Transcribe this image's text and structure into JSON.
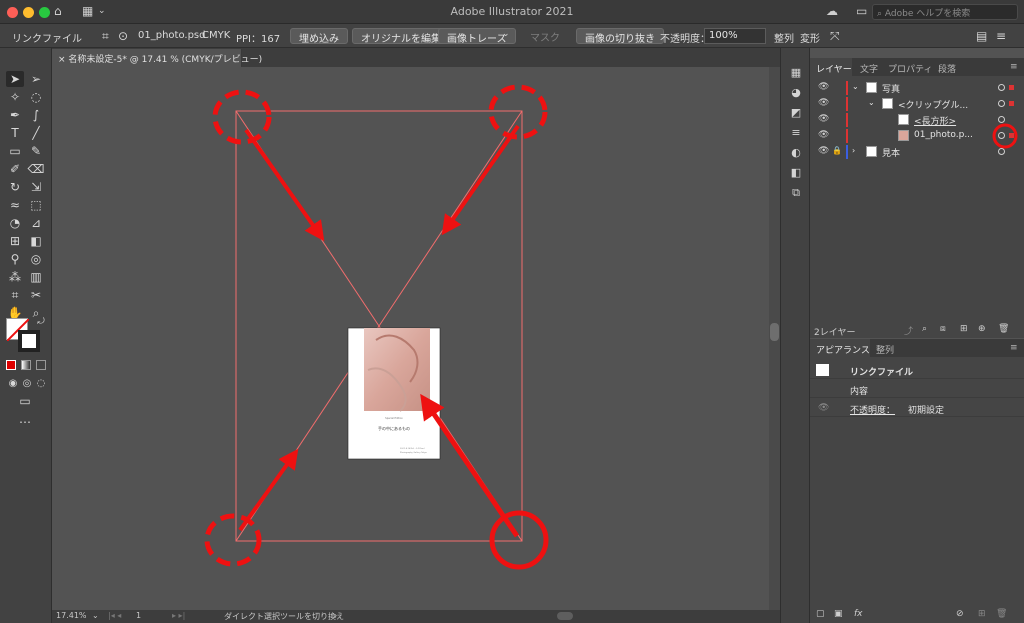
{
  "window": {
    "title": "Adobe Illustrator 2021",
    "help_search_placeholder": "Adobe ヘルプを検索"
  },
  "control_bar": {
    "object_type": "リンクファイル",
    "file_name": "01_photo.psd",
    "color_mode": "CMYK",
    "ppi": "PPI：167",
    "embed_button": "埋め込み",
    "edit_original_button": "オリジナルを編集",
    "image_trace_button": "画像トレース",
    "mask_button": "マスク",
    "crop_button": "画像の切り抜き",
    "opacity_label": "不透明度：",
    "opacity_value": "100%",
    "align_label": "整列",
    "transform_label": "変形"
  },
  "document_tab": {
    "title": "名称未設定-5* @ 17.41 % (CMYK/プレビュー)"
  },
  "status_bar": {
    "zoom": "17.41%",
    "artboard": "1",
    "tool_hint": "ダイレクト選択ツールを切り換え"
  },
  "artboard_content": {
    "subtitle": "Special Edition",
    "caption": "手の中にあるもの",
    "footer_line_1": "2021.4.16(Fri) - 5.9(Sun)",
    "footer_line_2": "Photography Gallery Tokyo"
  },
  "layers_panel": {
    "tabs": [
      "レイヤー",
      "文字",
      "プロパティ",
      "段落"
    ],
    "active_tab": "レイヤー",
    "rows": [
      {
        "name": "写真"
      },
      {
        "name": "<クリップグル..."
      },
      {
        "name": "<長方形>"
      },
      {
        "name": "01_photo.p..."
      },
      {
        "name": "見本"
      }
    ],
    "footer_count": "2レイヤー"
  },
  "appearance_panel": {
    "tabs": [
      "アピアランス",
      "整列"
    ],
    "active_tab": "アピアランス",
    "item_title": "リンクファイル",
    "contents_label": "内容",
    "opacity_label": "不透明度：",
    "opacity_value": "初期設定"
  },
  "annotation_colors": {
    "accent": "#ee1111"
  }
}
